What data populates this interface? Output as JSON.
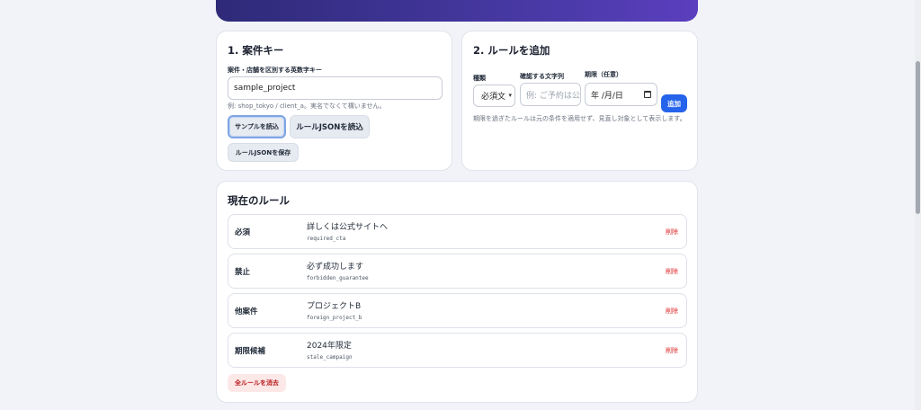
{
  "card1": {
    "title": "1. 案件キー",
    "field_label": "案件・店舗を区別する英数字キー",
    "input_value": "sample_project",
    "hint": "例: shop_tokyo / client_a。実名でなくて構いません。",
    "btn_sample": "サンプルを読込",
    "btn_load_json": "ルールJSONを読込",
    "btn_save_json": "ルールJSONを保存"
  },
  "card2": {
    "title": "2. ルールを追加",
    "type_label": "種類",
    "type_value": "必須文言",
    "text_label": "確認する文字列",
    "text_placeholder": "例: ご予約は公",
    "date_label": "期限（任意）",
    "date_value": "年 /月/日",
    "add_button": "追加",
    "note": "期限を過ぎたルールは元の条件を適用せず、見直し対象として表示します。"
  },
  "rules_card": {
    "title": "現在のルール",
    "rules": [
      {
        "type": "必須",
        "text": "詳しくは公式サイトへ",
        "id": "required_cta",
        "delete": "削除"
      },
      {
        "type": "禁止",
        "text": "必ず成功します",
        "id": "forbidden_guarantee",
        "delete": "削除"
      },
      {
        "type": "他案件",
        "text": "プロジェクトB",
        "id": "foreign_project_b",
        "delete": "削除"
      },
      {
        "type": "期限候補",
        "text": "2024年限定",
        "id": "stale_campaign",
        "delete": "削除"
      }
    ],
    "clear_button": "全ルールを消去"
  },
  "colors": {
    "hero_start": "#2e2a78",
    "hero_end": "#5b3fbe",
    "primary": "#2563eb",
    "danger": "#dc2626"
  }
}
